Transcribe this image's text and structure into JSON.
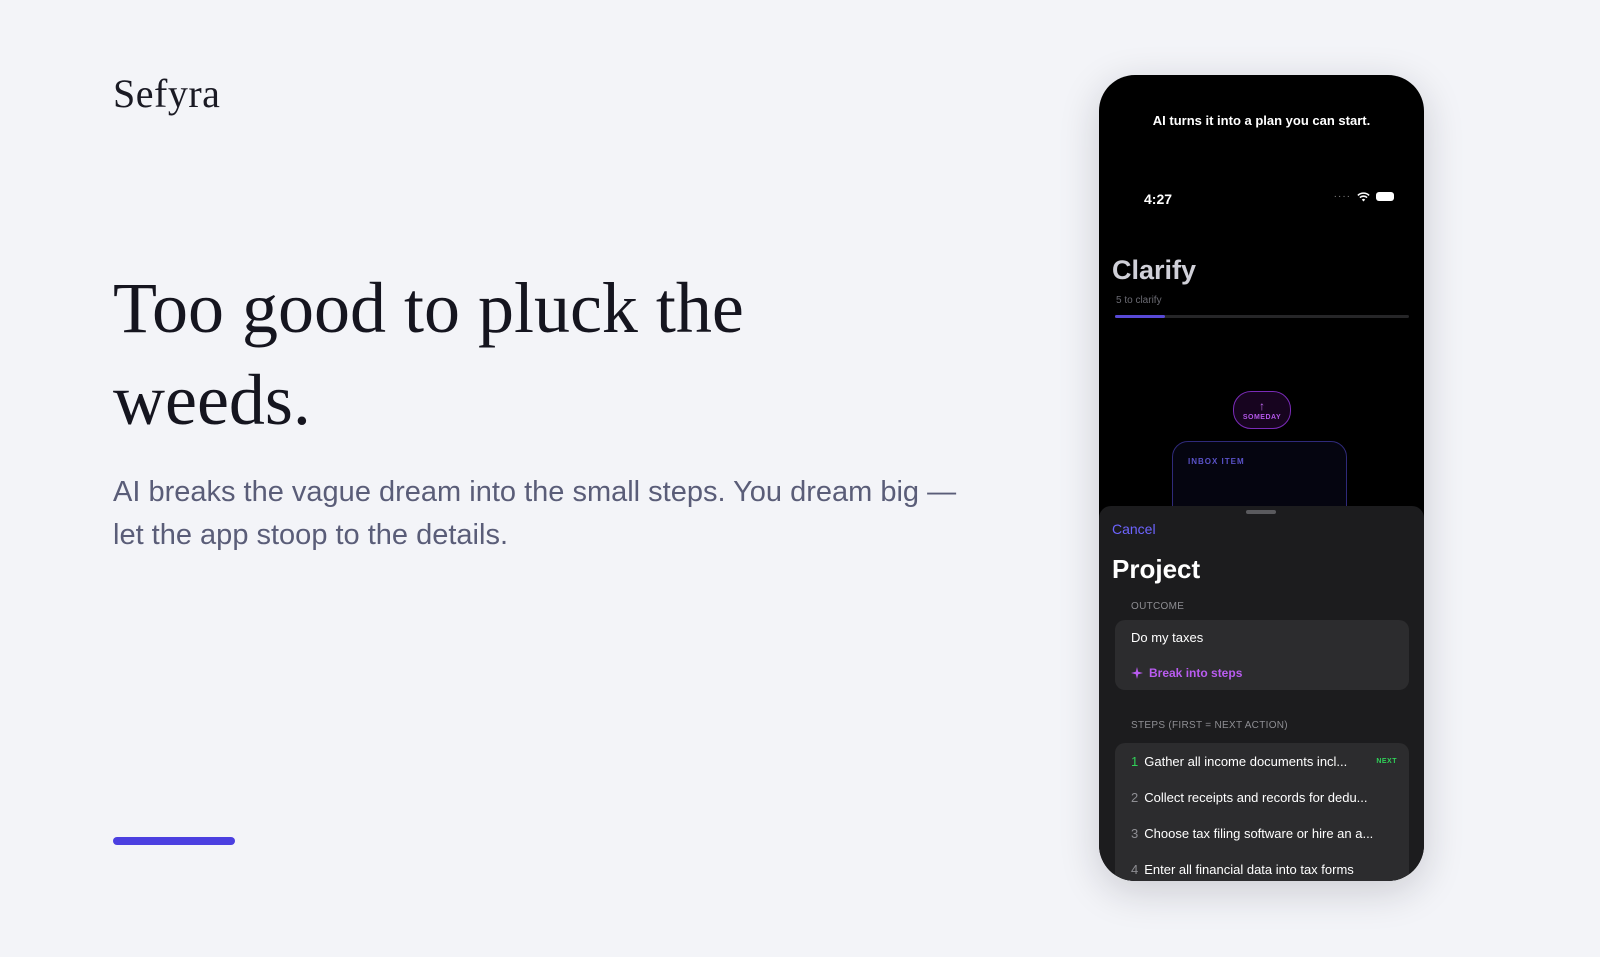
{
  "brand": "Sefyra",
  "hero": {
    "headline": "Too good to pluck the weeds.",
    "subtext": "AI breaks the vague dream into the small steps. You dream big — let the app stoop to the details."
  },
  "phone": {
    "caption": "AI turns it into a plan you can start.",
    "status_time": "4:27",
    "clarify": {
      "title": "Clarify",
      "subtitle": "5 to clarify",
      "progress": 0.17
    },
    "someday_label": "SOMEDAY",
    "inbox_label": "INBOX ITEM",
    "sheet": {
      "cancel_label": "Cancel",
      "title": "Project",
      "outcome_label": "OUTCOME",
      "outcome_value": "Do my taxes",
      "break_steps_label": "Break into steps",
      "steps_label": "STEPS (FIRST = NEXT ACTION)",
      "next_badge": "NEXT",
      "steps": [
        {
          "num": "1",
          "text": "Gather all income documents incl..."
        },
        {
          "num": "2",
          "text": "Collect receipts and records for dedu..."
        },
        {
          "num": "3",
          "text": "Choose tax filing software or hire an a..."
        },
        {
          "num": "4",
          "text": "Enter all financial data into tax forms"
        }
      ]
    }
  },
  "colors": {
    "accent": "#4b3fe0",
    "link": "#6d64ff",
    "magic": "#b95cf0",
    "next_green": "#30d158"
  }
}
